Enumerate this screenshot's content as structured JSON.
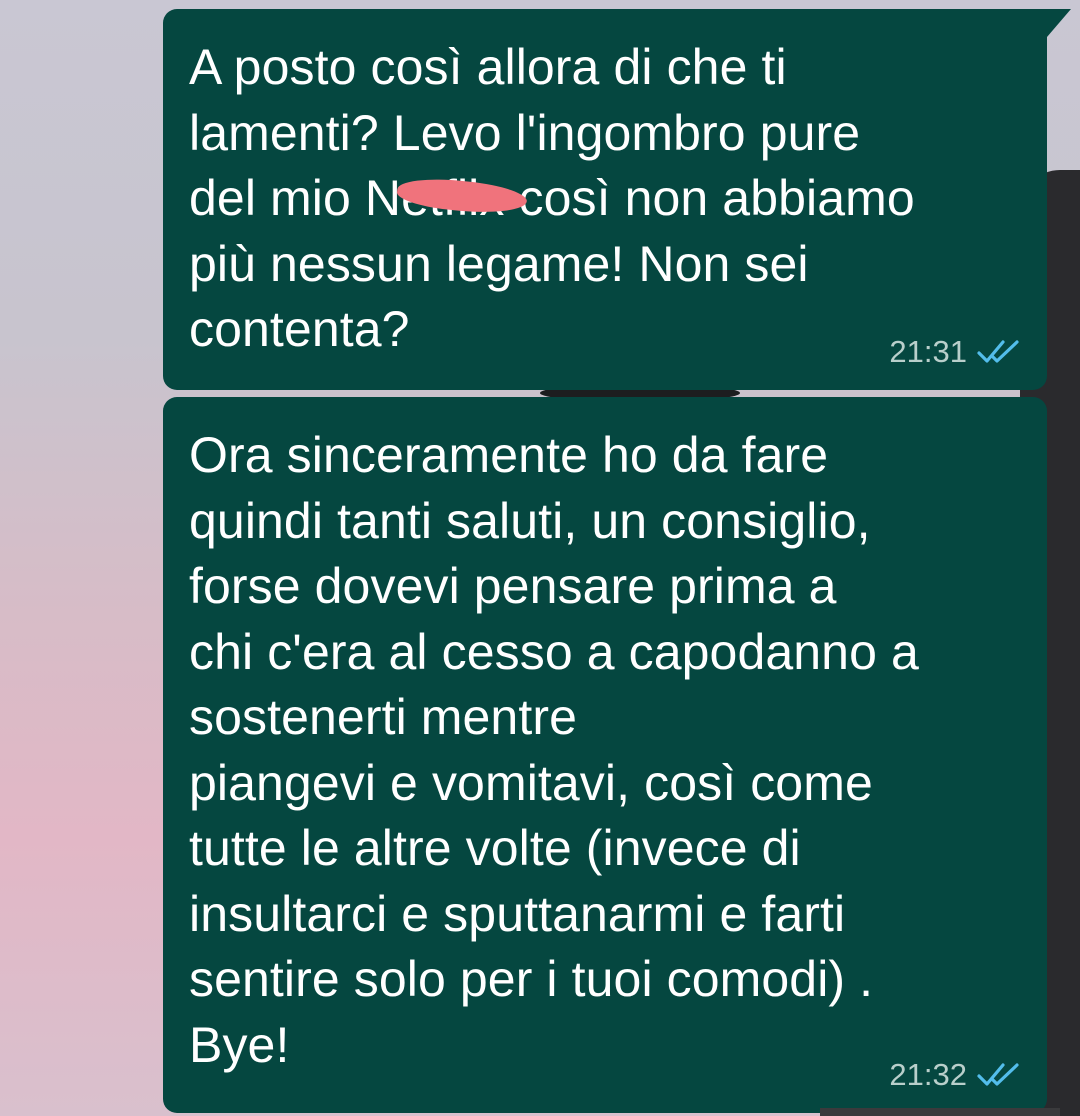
{
  "messages": [
    {
      "text": "A posto così allora di che ti\nlamenti? Levo l'ingombro pure\ndel mio Netflix così non abbiamo\npiù nessun legame! Non sei\ncontenta?",
      "time": "21:31",
      "status_icon": "double-check-read-icon"
    },
    {
      "text": "Ora sinceramente ho da fare\nquindi tanti saluti, un consiglio,\nforse dovevi pensare prima a\nchi c'era al cesso a capodanno a\nsostenerti mentre\npiangevi e vomitavi, così come\ntutte le altre volte (invece di\ninsultarci e sputtanarmi e farti\nsentire solo per i tuoi comodi) .\nBye!",
      "time": "21:32",
      "status_icon": "double-check-read-icon"
    }
  ],
  "colors": {
    "bubble": "#054740",
    "text": "#ffffff",
    "time": "#b9cfcb",
    "read_ticks": "#53bdeb",
    "redaction": "#f0737c"
  }
}
